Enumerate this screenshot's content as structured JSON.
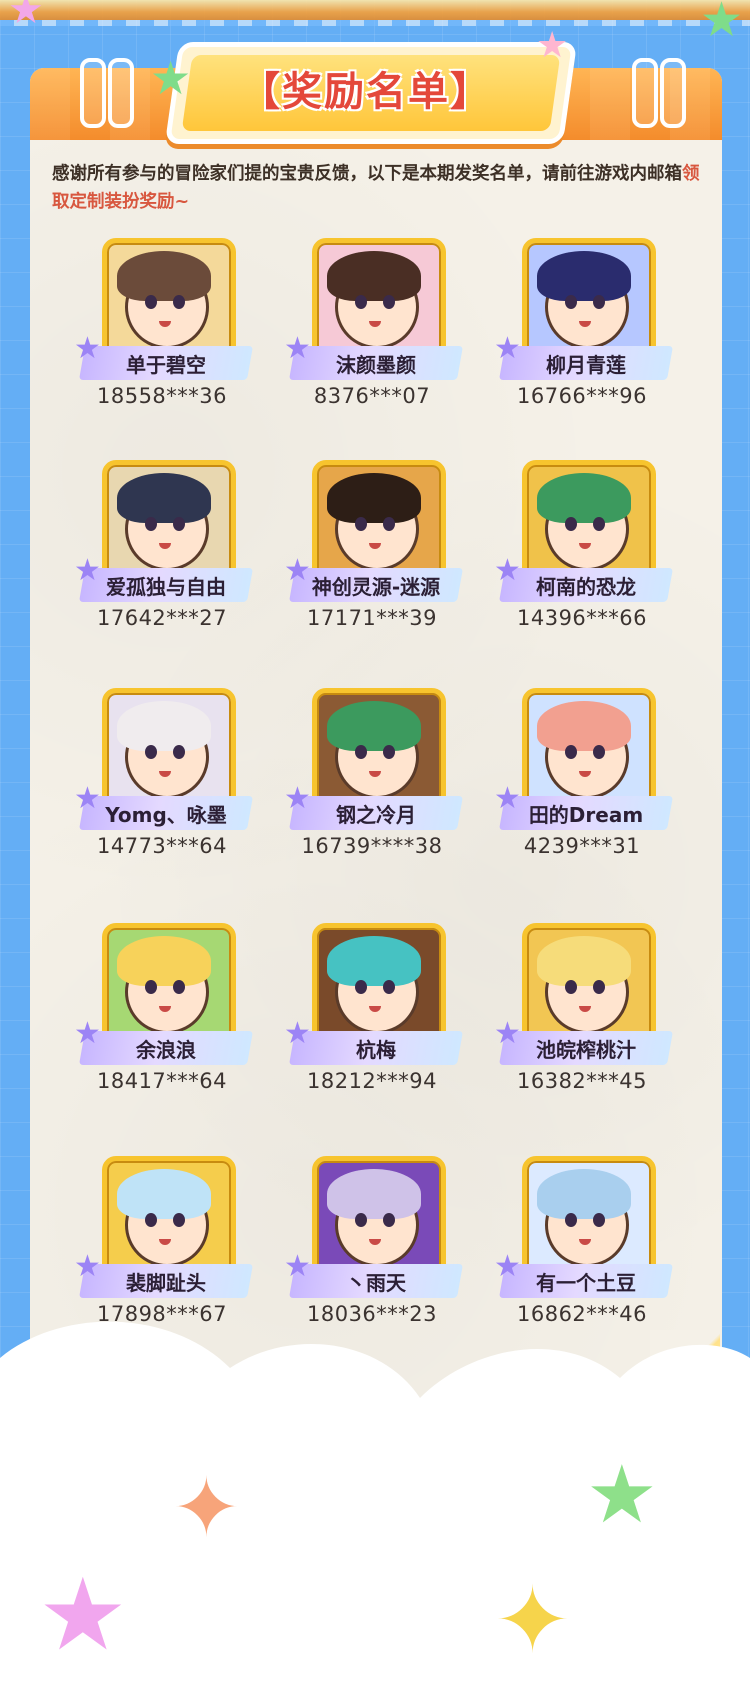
{
  "title": "【奖励名单】",
  "intro": {
    "text_1": "感谢所有参与的冒险家们提的宝贵反馈，以下是本期发奖名单，请前往游戏内邮箱",
    "text_highlight": "领取定制装扮奖励~"
  },
  "winners": [
    {
      "name": "单于碧空",
      "id": "18558***36",
      "hair": "#6b4b3a",
      "bg": "#f4d99a"
    },
    {
      "name": "沫颜墨颜",
      "id": "8376***07",
      "hair": "#4a2e24",
      "bg": "#f6c9d6"
    },
    {
      "name": "柳月青莲",
      "id": "16766***96",
      "hair": "#2a2c6e",
      "bg": "#b6c7ff"
    },
    {
      "name": "爱孤独与自由",
      "id": "17642***27",
      "hair": "#2f3650",
      "bg": "#e8d7b0"
    },
    {
      "name": "神创灵源-迷源",
      "id": "17171***39",
      "hair": "#2d1e16",
      "bg": "#e6a64a"
    },
    {
      "name": "柯南的恐龙",
      "id": "14396***66",
      "hair": "#3c9a5e",
      "bg": "#f0c24a"
    },
    {
      "name": "Yomg、咏墨",
      "id": "14773***64",
      "hair": "#f0ecee",
      "bg": "#e8e2ef"
    },
    {
      "name": "钢之冷月",
      "id": "16739****38",
      "hair": "#3c9a5e",
      "bg": "#8b5a34"
    },
    {
      "name": "田的Dream",
      "id": "4239***31",
      "hair": "#f2a090",
      "bg": "#cfe2ff"
    },
    {
      "name": "余浪浪",
      "id": "18417***64",
      "hair": "#f7d25a",
      "bg": "#a6d873"
    },
    {
      "name": "杭梅",
      "id": "18212***94",
      "hair": "#46c2c2",
      "bg": "#7a4a2a"
    },
    {
      "name": "池皖榨桃汁",
      "id": "16382***45",
      "hair": "#f6dc7a",
      "bg": "#f2c653"
    },
    {
      "name": "裴脚趾头",
      "id": "17898***67",
      "hair": "#bfe3f7",
      "bg": "#f5cd4c"
    },
    {
      "name": "丶雨天",
      "id": "18036***23",
      "hair": "#cfc2e8",
      "bg": "#7a4ab8"
    },
    {
      "name": "有一个土豆",
      "id": "16862***46",
      "hair": "#a9cfee",
      "bg": "#dceaff"
    }
  ]
}
